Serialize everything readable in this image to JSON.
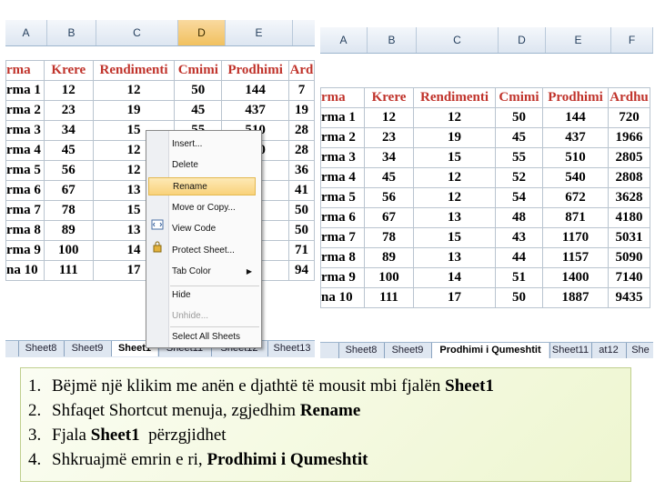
{
  "left": {
    "column_headers": [
      "A",
      "B",
      "C",
      "D",
      "E"
    ],
    "selected_column": "D",
    "table": {
      "headers": [
        "rma",
        "Krere",
        "Rendimenti",
        "Cmimi",
        "Prodhimi",
        "Ard"
      ],
      "rows": [
        [
          "rma 1",
          "12",
          "12",
          "50",
          "144",
          "7"
        ],
        [
          "rma 2",
          "23",
          "19",
          "45",
          "437",
          "19"
        ],
        [
          "rma 3",
          "34",
          "15",
          "55",
          "510",
          "28"
        ],
        [
          "rma 4",
          "45",
          "12",
          "",
          "540",
          "28"
        ],
        [
          "rma 5",
          "56",
          "12",
          "",
          "72",
          "36"
        ],
        [
          "rma 6",
          "67",
          "13",
          "",
          "71",
          "41"
        ],
        [
          "rma 7",
          "78",
          "15",
          "",
          "70",
          "50"
        ],
        [
          "rma 8",
          "89",
          "13",
          "",
          "57",
          "50"
        ],
        [
          "rma 9",
          "100",
          "14",
          "",
          "00",
          "71"
        ],
        [
          "na 10",
          "111",
          "17",
          "",
          "87",
          "94"
        ]
      ]
    },
    "tabs": [
      "Sheet8",
      "Sheet9",
      "Sheet1",
      "Sheet11",
      "Sheet12",
      "Sheet13"
    ],
    "active_tab": "Sheet1"
  },
  "context_menu": {
    "items": [
      "Insert...",
      "Delete",
      "Rename",
      "Move or Copy...",
      "View Code",
      "Protect Sheet...",
      "Tab Color",
      "Hide",
      "Unhide...",
      "Select All Sheets"
    ],
    "highlighted": "Rename",
    "disabled": [
      "Unhide..."
    ],
    "submenu": [
      "Tab Color"
    ]
  },
  "right": {
    "column_headers": [
      "A",
      "B",
      "C",
      "D",
      "E",
      "F"
    ],
    "table": {
      "headers": [
        "rma",
        "Krere",
        "Rendimenti",
        "Cmimi",
        "Prodhimi",
        "Ardhu"
      ],
      "rows": [
        [
          "rma 1",
          "12",
          "12",
          "50",
          "144",
          "720"
        ],
        [
          "rma 2",
          "23",
          "19",
          "45",
          "437",
          "1966"
        ],
        [
          "rma 3",
          "34",
          "15",
          "55",
          "510",
          "2805"
        ],
        [
          "rma 4",
          "45",
          "12",
          "52",
          "540",
          "2808"
        ],
        [
          "rma 5",
          "56",
          "12",
          "54",
          "672",
          "3628"
        ],
        [
          "rma 6",
          "67",
          "13",
          "48",
          "871",
          "4180"
        ],
        [
          "rma 7",
          "78",
          "15",
          "43",
          "1170",
          "5031"
        ],
        [
          "rma 8",
          "89",
          "13",
          "44",
          "1157",
          "5090"
        ],
        [
          "rma 9",
          "100",
          "14",
          "51",
          "1400",
          "7140"
        ],
        [
          "na 10",
          "111",
          "17",
          "50",
          "1887",
          "9435"
        ]
      ]
    },
    "tabs": [
      "Sheet8",
      "Sheet9",
      "Prodhimi i Qumeshtit",
      "Sheet11",
      "at12",
      "She"
    ],
    "active_tab": "Prodhimi i Qumeshtit"
  },
  "instructions": [
    {
      "num": "1.",
      "pre": "Bëjmë një klikim me anën e djathtë të mousit mbi fjalën ",
      "bold": "Sheet1",
      "post": ""
    },
    {
      "num": "2.",
      "pre": "Shfaqet Shortcut menuja, zgjedhim ",
      "bold": "Rename",
      "post": ""
    },
    {
      "num": "3.",
      "pre": "Fjala ",
      "bold": "Sheet1",
      "post": "  përzgjidhet"
    },
    {
      "num": "4.",
      "pre": "Shkruajmë emrin e ri, ",
      "bold": "Prodhimi i Qumeshtit",
      "post": ""
    }
  ],
  "colors": {
    "header_text": "#c0332b",
    "menu_highlight": "#f9d27a",
    "selected_col": "#f1c15f",
    "instruction_bg": "#eef6d0"
  }
}
